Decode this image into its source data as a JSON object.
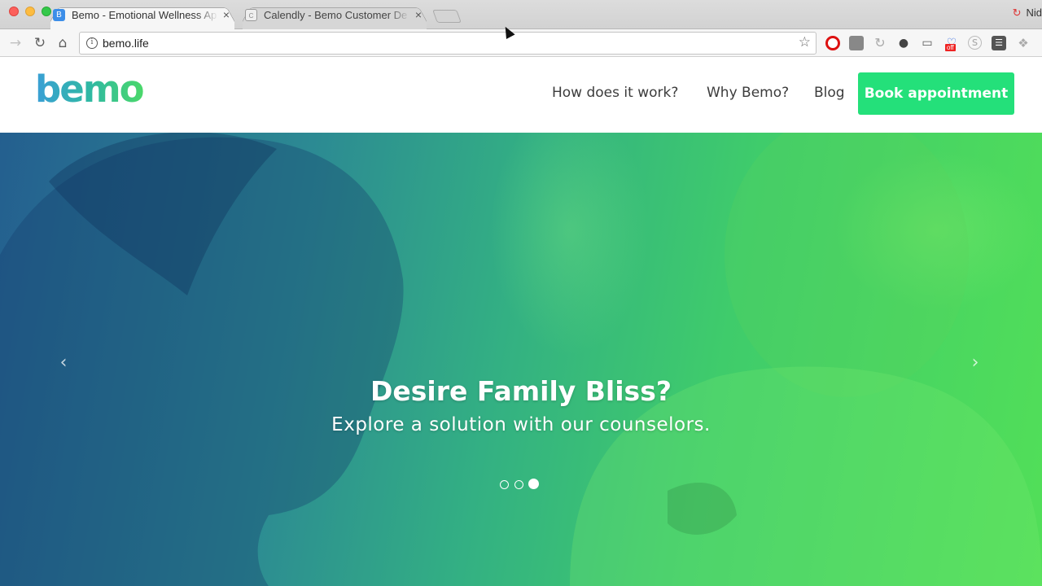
{
  "browser": {
    "tabs": [
      {
        "title": "Bemo - Emotional Wellness Ap",
        "favicon": "B",
        "active": true
      },
      {
        "title": "Calendly - Bemo Customer De",
        "favicon": "C",
        "active": false
      }
    ],
    "close_glyph": "×",
    "profile_name": "Nid",
    "url": "bemo.life",
    "extensions": [
      "opera-icon",
      "pocket-icon",
      "rotate-icon",
      "evernote-icon",
      "cast-icon",
      "shop-off-icon",
      "skype-icon",
      "menu-icon",
      "dropbox-icon"
    ],
    "shop_badge": "off"
  },
  "site": {
    "logo": "bemo",
    "nav": {
      "how": "How does it work?",
      "why": "Why Bemo?",
      "blog": "Blog"
    },
    "cta": "Book appointment",
    "colors": {
      "cta": "#24e07a",
      "logo_start": "#3a9fd6",
      "logo_end": "#4ad86a"
    }
  },
  "hero": {
    "title": "Desire Family Bliss?",
    "subtitle": "Explore a solution with our counselors.",
    "slides_total": 3,
    "slide_active": 3,
    "prev_glyph": "‹",
    "next_glyph": "›"
  }
}
